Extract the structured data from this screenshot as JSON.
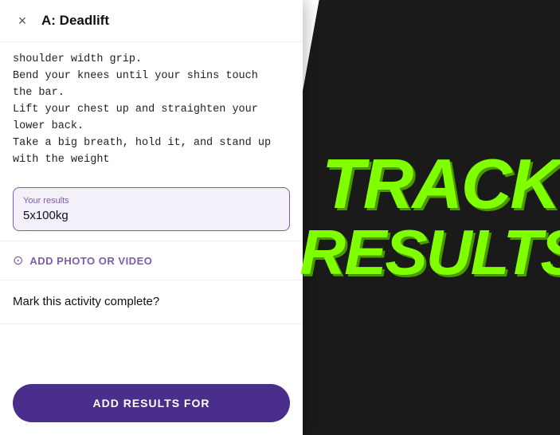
{
  "header": {
    "close_label": "×",
    "title": "A: Deadlift"
  },
  "instructions": {
    "text": "shoulder width grip.\nBend your knees until your shins touch\nthe bar.\nLift your chest up and straighten your\nlower back.\nTake a big breath, hold it, and stand up\nwith the weight"
  },
  "results": {
    "label": "Your results",
    "value": "5x100kg"
  },
  "media": {
    "label": "ADD PHOTO OR VIDEO"
  },
  "mark_complete": {
    "text": "Mark this activity complete?"
  },
  "add_button": {
    "label": "ADD RESULTS FOR"
  },
  "track_results": {
    "line1": "TRACK",
    "line2": "RESULTS"
  }
}
